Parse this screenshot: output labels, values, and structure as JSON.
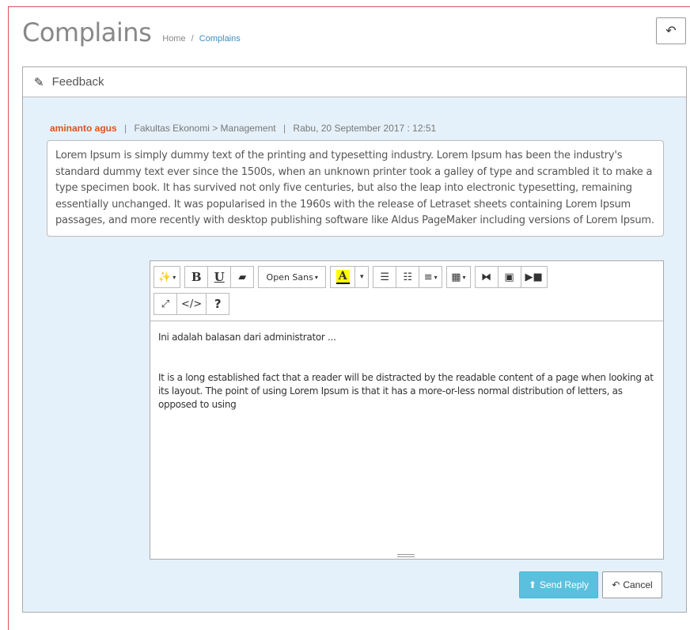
{
  "header": {
    "title": "Complains",
    "breadcrumb": {
      "home": "Home",
      "separator": "/",
      "current": "Complains"
    },
    "back_icon": "reply-icon"
  },
  "panel": {
    "heading": "Feedback",
    "heading_icon": "pencil-icon",
    "meta": {
      "author": "aminanto agus",
      "faculty": "Fakultas Ekonomi > Management",
      "date": "Rabu, 20 September 2017 : 12:51",
      "divider": "|"
    },
    "message": "Lorem Ipsum is simply dummy text of the printing and typesetting industry. Lorem Ipsum has been the industry's standard dummy text ever since the 1500s, when an unknown printer took a galley of type and scrambled it to make a type specimen book. It has survived not only five centuries, but also the leap into electronic typesetting, remaining essentially unchanged. It was popularised in the 1960s with the release of Letraset sheets containing Lorem Ipsum passages, and more recently with desktop publishing software like Aldus PageMaker including versions of Lorem Ipsum."
  },
  "editor": {
    "toolbar": {
      "style_icon": "magic-wand-icon",
      "bold": "B",
      "underline": "U",
      "eraser_icon": "eraser-icon",
      "font_name": "Open Sans",
      "color_letter": "A",
      "ul_icon": "unordered-list-icon",
      "ol_icon": "ordered-list-icon",
      "align_icon": "align-icon",
      "table_icon": "table-icon",
      "link_icon": "link-icon",
      "image_icon": "image-icon",
      "video_icon": "video-icon",
      "fullscreen_icon": "fullscreen-icon",
      "code_label": "</>",
      "help_label": "?"
    },
    "line1": "Ini adalah balasan dari administrator ...",
    "line2": "It is a long established fact that a reader will be distracted by the readable content of a page when looking at its layout. The point of using Lorem Ipsum is that it has a more-or-less normal distribution of letters, as opposed to using"
  },
  "actions": {
    "send_label": "Send Reply",
    "cancel_label": "Cancel"
  },
  "colors": {
    "accent": "#5bc0de",
    "author": "#e0521c",
    "panel_bg": "#e5f1fa",
    "frame": "#d9534f"
  }
}
